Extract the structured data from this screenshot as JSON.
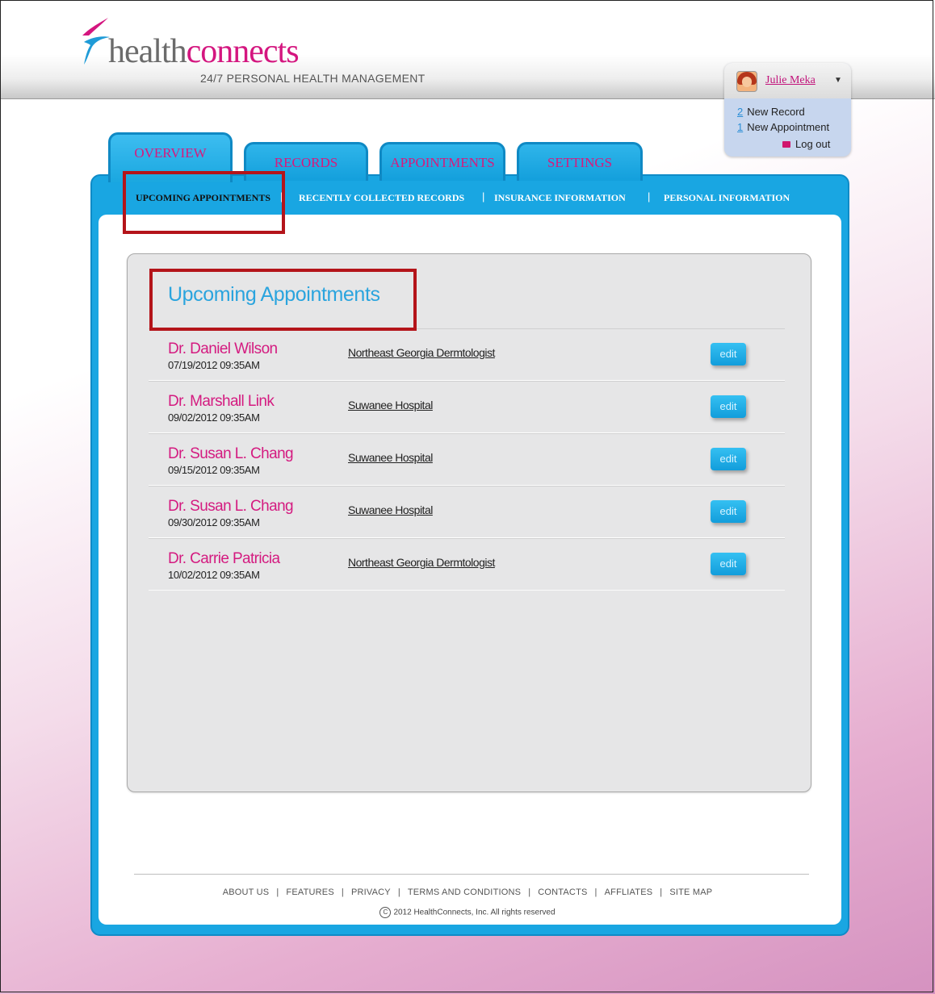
{
  "brand": {
    "name_part1": "health",
    "name_part2": "connects",
    "tagline": "24/7 PERSONAL HEALTH MANAGEMENT"
  },
  "user": {
    "name": "Julie Meka",
    "icon": "avatar-icon",
    "notifications": [
      {
        "count": "2",
        "label": "New Record"
      },
      {
        "count": "1",
        "label": "New Appointment"
      }
    ],
    "logout_label": "Log out"
  },
  "tabs": [
    {
      "label": "OVERVIEW",
      "active": true
    },
    {
      "label": "RECORDS"
    },
    {
      "label": "APPOINTMENTS"
    },
    {
      "label": "SETTINGS"
    }
  ],
  "subnav": [
    {
      "label": "UPCOMING APPOINTMENTS",
      "active": true
    },
    {
      "label": "RECENTLY COLLECTED RECORDS"
    },
    {
      "label": "INSURANCE INFORMATION"
    },
    {
      "label": "PERSONAL INFORMATION"
    }
  ],
  "appointments": {
    "title": "Upcoming Appointments",
    "edit_label": "edit",
    "rows": [
      {
        "doctor": "Dr. Daniel Wilson",
        "datetime": "07/19/2012 09:35AM",
        "location": "Northeast Georgia Dermtologist"
      },
      {
        "doctor": "Dr. Marshall Link",
        "datetime": "09/02/2012 09:35AM",
        "location": "Suwanee Hospital"
      },
      {
        "doctor": "Dr. Susan L. Chang",
        "datetime": "09/15/2012 09:35AM",
        "location": "Suwanee Hospital"
      },
      {
        "doctor": "Dr. Susan L. Chang",
        "datetime": "09/30/2012 09:35AM",
        "location": "Suwanee Hospital"
      },
      {
        "doctor": "Dr. Carrie Patricia",
        "datetime": "10/02/2012 09:35AM",
        "location": "Northeast Georgia Dermtologist"
      }
    ]
  },
  "footer": {
    "links": [
      "ABOUT US",
      "FEATURES",
      "PRIVACY",
      "TERMS AND CONDITIONS",
      "CONTACTS",
      "AFFLIATES",
      "SITE MAP"
    ],
    "separator": "|",
    "copyright_symbol": "C",
    "copyright": "2012 HealthConnects, Inc.  All rights reserved"
  },
  "colors": {
    "accent_blue": "#19a6e2",
    "brand_pink": "#d4167f",
    "highlight_red": "#b4141a"
  }
}
